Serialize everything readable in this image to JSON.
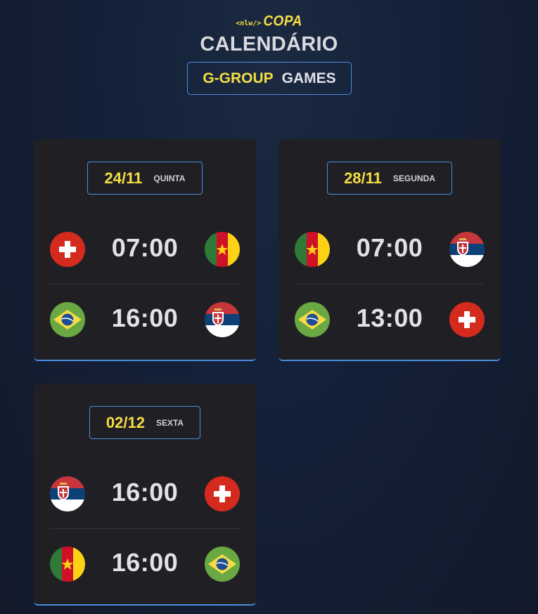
{
  "header": {
    "logo_prefix": "<nlw/>",
    "logo_word": "COPA",
    "title": "CALENDÁRIO",
    "group_name": "G-GROUP",
    "group_suffix": "GAMES"
  },
  "colors": {
    "accent_yellow": "#f7dd43",
    "accent_blue": "#4a8be0",
    "card_bg": "#202024",
    "text": "#e1e1e6"
  },
  "cards": [
    {
      "date": "24/11",
      "weekday": "QUINTA",
      "matches": [
        {
          "home": "switzerland",
          "time": "07:00",
          "away": "cameroon"
        },
        {
          "home": "brazil",
          "time": "16:00",
          "away": "serbia"
        }
      ]
    },
    {
      "date": "28/11",
      "weekday": "SEGUNDA",
      "matches": [
        {
          "home": "cameroon",
          "time": "07:00",
          "away": "serbia"
        },
        {
          "home": "brazil",
          "time": "13:00",
          "away": "switzerland"
        }
      ]
    },
    {
      "date": "02/12",
      "weekday": "SEXTA",
      "matches": [
        {
          "home": "serbia",
          "time": "16:00",
          "away": "switzerland"
        },
        {
          "home": "cameroon",
          "time": "16:00",
          "away": "brazil"
        }
      ]
    }
  ]
}
